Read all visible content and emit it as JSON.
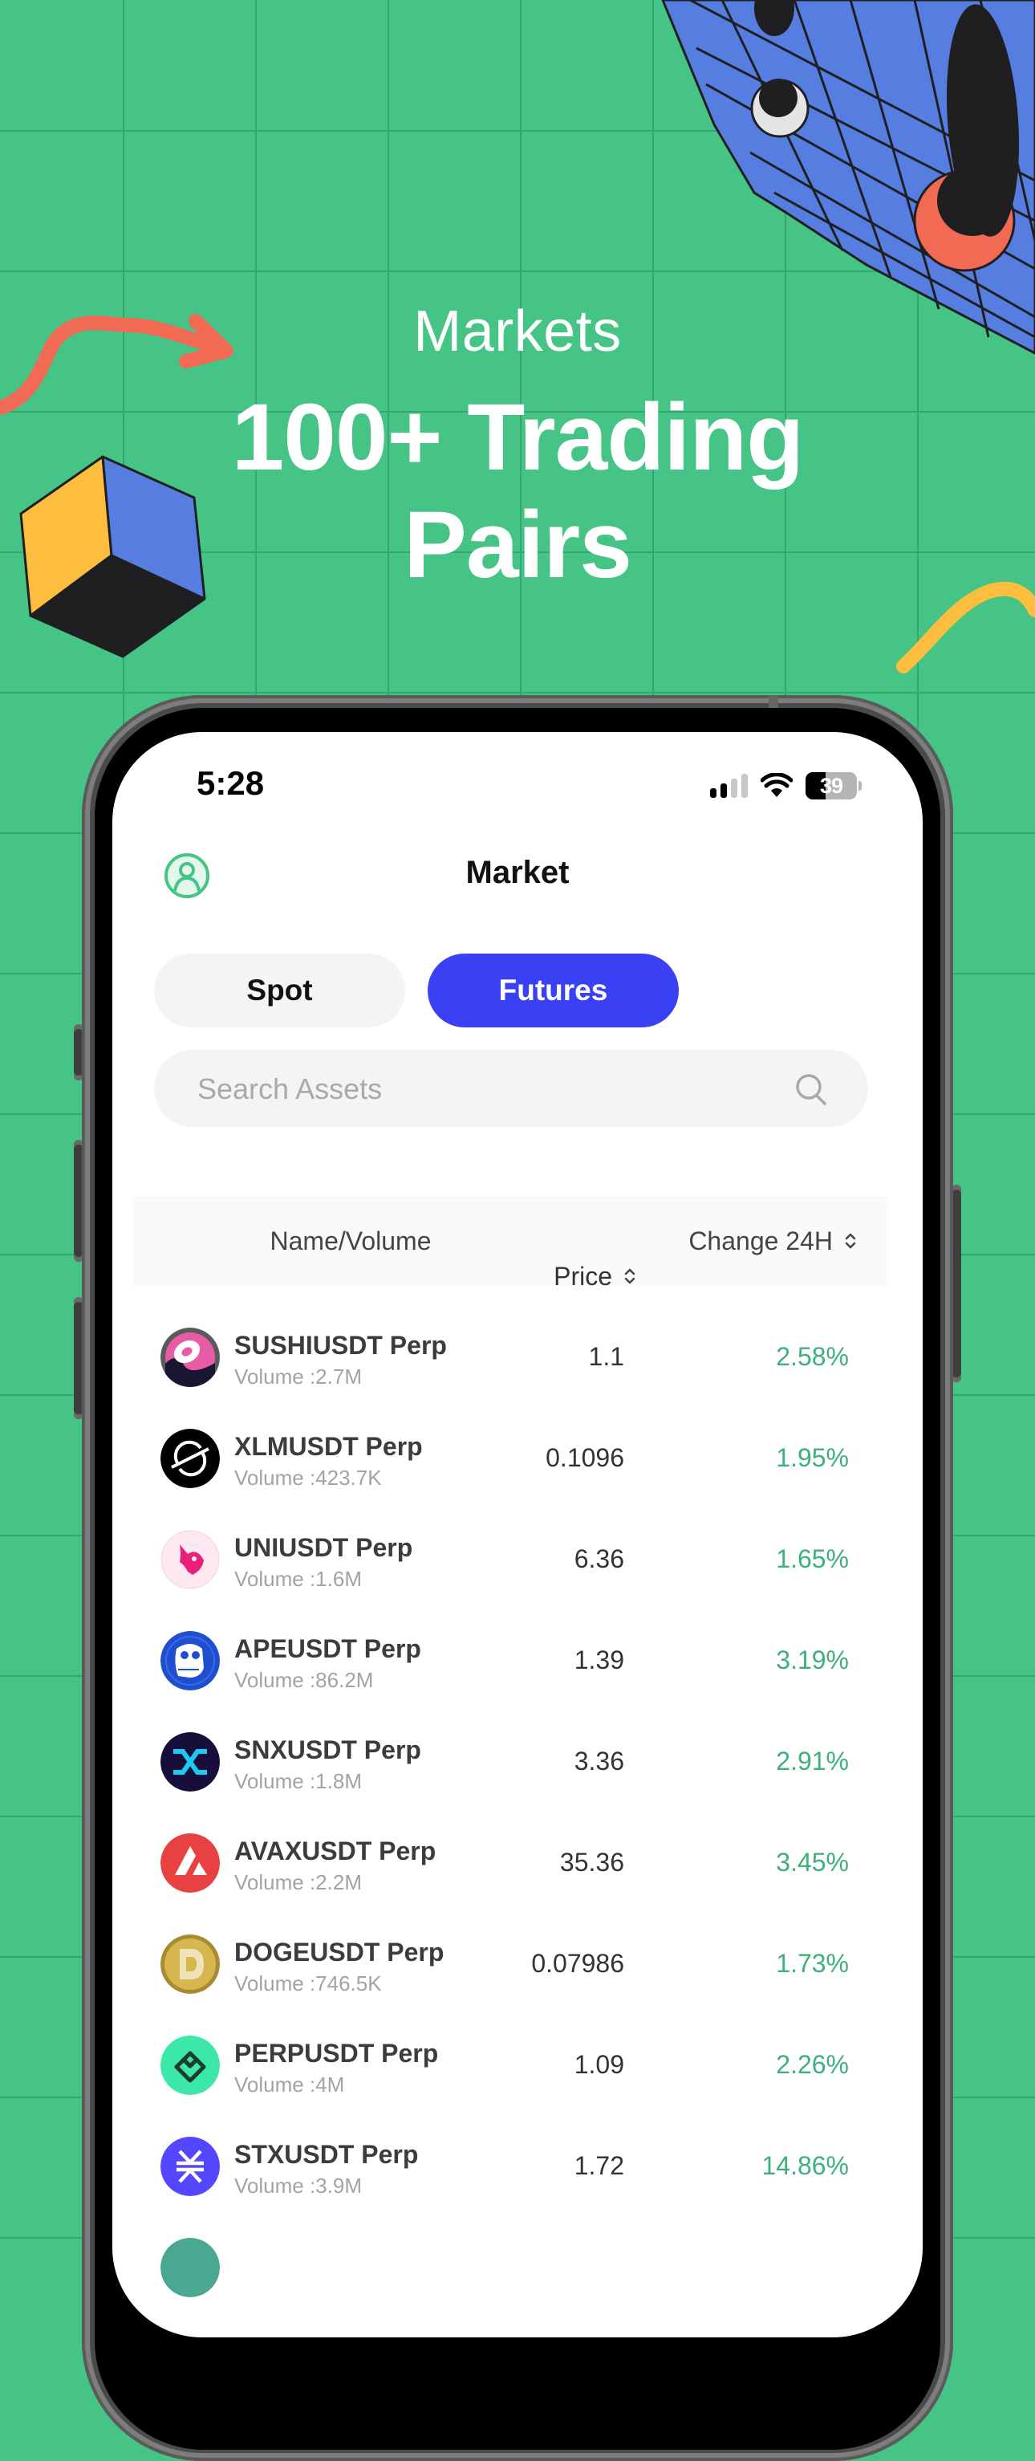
{
  "hero": {
    "subtitle": "Markets",
    "title_line1": "100+ Trading",
    "title_line2": "Pairs"
  },
  "colors": {
    "background": "#46c486",
    "accent_blue": "#3a41f5",
    "positive": "#3eb07a",
    "avatar_green": "#46c486"
  },
  "status_bar": {
    "time": "5:28",
    "signal_bars_active": 2,
    "signal_bars_total": 4,
    "wifi_icon": "wifi-icon",
    "battery_percent": "39",
    "battery_level": 0.39
  },
  "header": {
    "title": "Market",
    "avatar_icon": "user-circle-icon"
  },
  "tabs": [
    {
      "label": "Spot",
      "active": false
    },
    {
      "label": "Futures",
      "active": true
    }
  ],
  "search": {
    "placeholder": "Search Assets",
    "value": "",
    "icon": "search-icon"
  },
  "table": {
    "columns": {
      "name": "Name/Volume",
      "price": "Price",
      "change": "Change 24H"
    },
    "rows": [
      {
        "icon": "sushi-icon",
        "pair": "SUSHIUSDT Perp",
        "volume": "Volume :2.7M",
        "price": "1.1",
        "change": "2.58%"
      },
      {
        "icon": "stellar-xlm-icon",
        "pair": "XLMUSDT Perp",
        "volume": "Volume :423.7K",
        "price": "0.1096",
        "change": "1.95%"
      },
      {
        "icon": "uniswap-icon",
        "pair": "UNIUSDT Perp",
        "volume": "Volume :1.6M",
        "price": "6.36",
        "change": "1.65%"
      },
      {
        "icon": "apecoin-icon",
        "pair": "APEUSDT Perp",
        "volume": "Volume :86.2M",
        "price": "1.39",
        "change": "3.19%"
      },
      {
        "icon": "synthetix-icon",
        "pair": "SNXUSDT Perp",
        "volume": "Volume :1.8M",
        "price": "3.36",
        "change": "2.91%"
      },
      {
        "icon": "avalanche-icon",
        "pair": "AVAXUSDT Perp",
        "volume": "Volume :2.2M",
        "price": "35.36",
        "change": "3.45%"
      },
      {
        "icon": "dogecoin-icon",
        "pair": "DOGEUSDT Perp",
        "volume": "Volume :746.5K",
        "price": "0.07986",
        "change": "1.73%"
      },
      {
        "icon": "perpetual-protocol-icon",
        "pair": "PERPUSDT Perp",
        "volume": "Volume :4M",
        "price": "1.09",
        "change": "2.26%"
      },
      {
        "icon": "stacks-icon",
        "pair": "STXUSDT Perp",
        "volume": "Volume :3.9M",
        "price": "1.72",
        "change": "14.86%"
      }
    ]
  }
}
